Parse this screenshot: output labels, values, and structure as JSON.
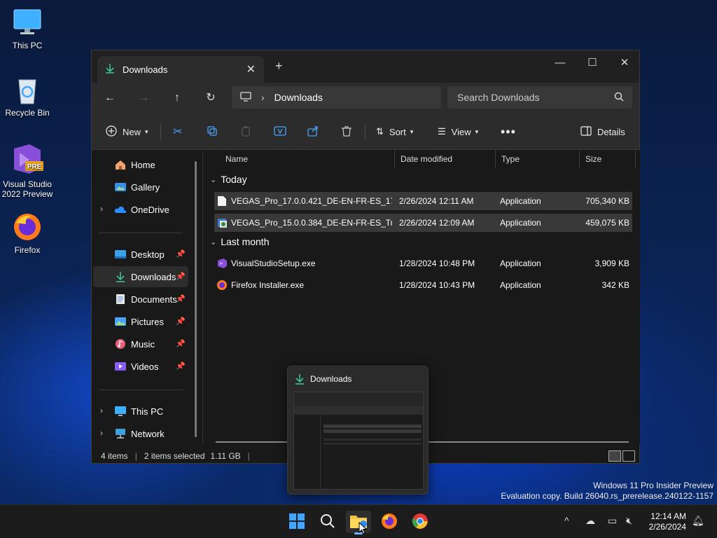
{
  "desktop": {
    "icons": [
      {
        "label": "This PC"
      },
      {
        "label": "Recycle Bin"
      },
      {
        "label": "Visual Studio 2022 Preview",
        "badge": "PRE"
      },
      {
        "label": "Firefox"
      }
    ]
  },
  "window": {
    "tab_title": "Downloads",
    "address": {
      "current": "Downloads"
    },
    "search_placeholder": "Search Downloads",
    "toolbar": {
      "new_label": "New",
      "sort_label": "Sort",
      "view_label": "View",
      "details_label": "Details"
    },
    "sidebar": {
      "top": [
        {
          "label": "Home"
        },
        {
          "label": "Gallery"
        },
        {
          "label": "OneDrive"
        }
      ],
      "pinned": [
        {
          "label": "Desktop"
        },
        {
          "label": "Downloads"
        },
        {
          "label": "Documents"
        },
        {
          "label": "Pictures"
        },
        {
          "label": "Music"
        },
        {
          "label": "Videos"
        }
      ],
      "bottom": [
        {
          "label": "This PC"
        },
        {
          "label": "Network"
        }
      ]
    },
    "columns": [
      "Name",
      "Date modified",
      "Type",
      "Size"
    ],
    "groups": [
      {
        "label": "Today",
        "files": [
          {
            "name": "VEGAS_Pro_17.0.0.421_DE-EN-FR-ES_17_0...",
            "date": "2/26/2024 12:11 AM",
            "type": "Application",
            "size": "705,340 KB",
            "selected": true
          },
          {
            "name": "VEGAS_Pro_15.0.0.384_DE-EN-FR-ES_Trial...",
            "date": "2/26/2024 12:09 AM",
            "type": "Application",
            "size": "459,075 KB",
            "selected": true
          }
        ]
      },
      {
        "label": "Last month",
        "files": [
          {
            "name": "VisualStudioSetup.exe",
            "date": "1/28/2024 10:48 PM",
            "type": "Application",
            "size": "3,909 KB",
            "selected": false
          },
          {
            "name": "Firefox Installer.exe",
            "date": "1/28/2024 10:43 PM",
            "type": "Application",
            "size": "342 KB",
            "selected": false
          }
        ]
      }
    ],
    "status": {
      "items": "4 items",
      "selected": "2 items selected",
      "size": "1.11 GB"
    }
  },
  "thumbnail": {
    "title": "Downloads"
  },
  "watermark": {
    "line1": "Windows 11 Pro Insider Preview",
    "line2": "Evaluation copy. Build 26040.rs_prerelease.240122-1157"
  },
  "taskbar": {
    "time": "12:14 AM",
    "date": "2/26/2024"
  },
  "colors": {
    "accent": "#3fa7ff",
    "folder": "#f2c84b",
    "selection": "#393939"
  }
}
